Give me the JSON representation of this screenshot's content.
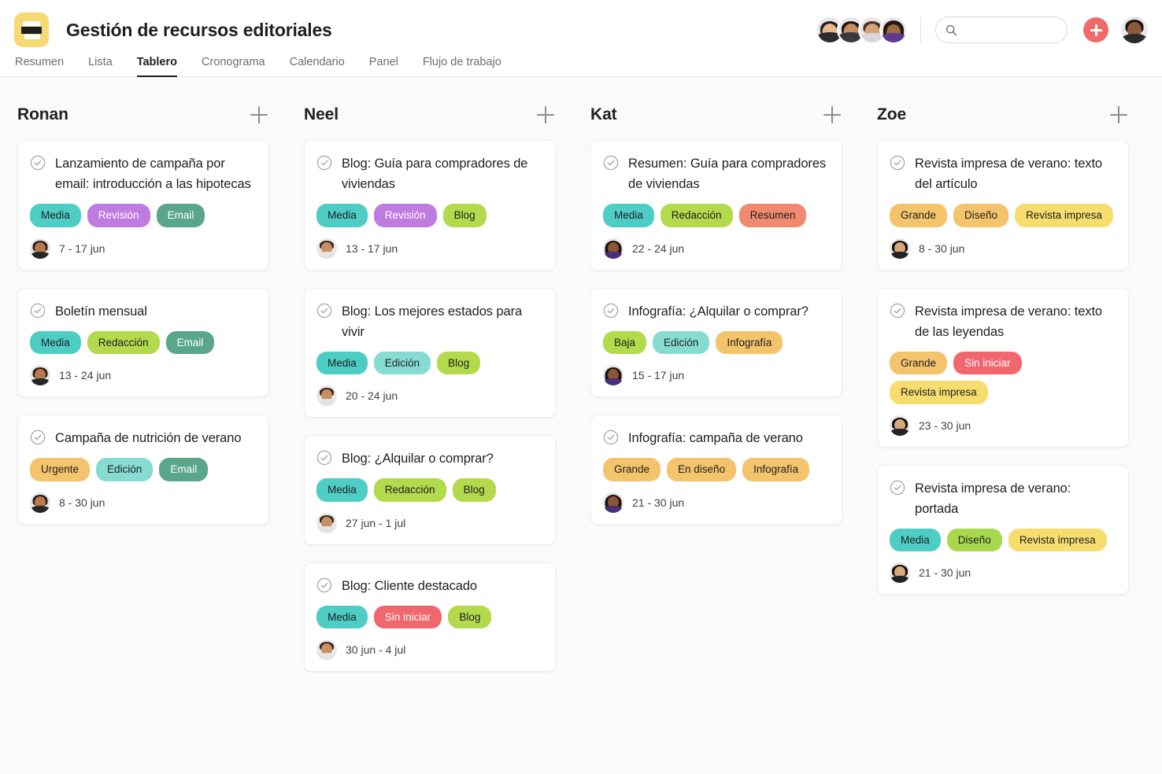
{
  "header": {
    "logo_icon": "project-logo-icon",
    "project_title": "Gestión de recursos editoriales",
    "search": {
      "placeholder": "",
      "value": "",
      "icon": "search-icon"
    },
    "add_button_label": "+",
    "member_avatars": [
      "member-1",
      "member-2",
      "member-3",
      "member-4"
    ],
    "current_user_avatar": "current-user"
  },
  "tabs": [
    {
      "label": "Resumen",
      "active": false
    },
    {
      "label": "Lista",
      "active": false
    },
    {
      "label": "Tablero",
      "active": true
    },
    {
      "label": "Cronograma",
      "active": false
    },
    {
      "label": "Calendario",
      "active": false
    },
    {
      "label": "Panel",
      "active": false
    },
    {
      "label": "Flujo de trabajo",
      "active": false
    }
  ],
  "tag_colors": {
    "Media": "#4ecdc4",
    "Revisión": "#c07be0",
    "Email": "#59a68a",
    "Redacción": "#b3d94c",
    "Urgente": "#f3c46b",
    "Edición": "#86dcd2",
    "Blog": "#b3d94c",
    "Sin iniciar": "#f2666e",
    "Resumen": "#ef8a6e",
    "Baja": "#b3d94c",
    "Infografía": "#f3c46b",
    "Grande": "#f3c46b",
    "En diseño": "#f3c46b",
    "Diseño-orange": "#f3c46b",
    "Diseño-green": "#a8d94c",
    "Revista impresa": "#f6dd6e"
  },
  "columns": [
    {
      "title": "Ronan",
      "add_label": "+",
      "avatar_kind": "ronan",
      "cards": [
        {
          "title": "Lanzamiento de campaña por email: introducción a las hipotecas",
          "tags": [
            {
              "label": "Media",
              "color": "#4ecdc4",
              "text_color": "#1e1f21"
            },
            {
              "label": "Revisión",
              "color": "#c07be0",
              "text_color": "#ffffff"
            },
            {
              "label": "Email",
              "color": "#59a68a",
              "text_color": "#ffffff"
            }
          ],
          "date": "7 - 17 jun"
        },
        {
          "title": "Boletín mensual",
          "tags": [
            {
              "label": "Media",
              "color": "#4ecdc4",
              "text_color": "#1e1f21"
            },
            {
              "label": "Redacción",
              "color": "#b3d94c",
              "text_color": "#1e1f21"
            },
            {
              "label": "Email",
              "color": "#59a68a",
              "text_color": "#ffffff"
            }
          ],
          "date": "13 - 24 jun"
        },
        {
          "title": "Campaña de nutrición de verano",
          "tags": [
            {
              "label": "Urgente",
              "color": "#f3c46b",
              "text_color": "#1e1f21"
            },
            {
              "label": "Edición",
              "color": "#86dcd2",
              "text_color": "#1e1f21"
            },
            {
              "label": "Email",
              "color": "#59a68a",
              "text_color": "#ffffff"
            }
          ],
          "date": "8 - 30 jun"
        }
      ]
    },
    {
      "title": "Neel",
      "add_label": "+",
      "avatar_kind": "neel",
      "cards": [
        {
          "title": "Blog: Guía para compradores de viviendas",
          "tags": [
            {
              "label": "Media",
              "color": "#4ecdc4",
              "text_color": "#1e1f21"
            },
            {
              "label": "Revisión",
              "color": "#c07be0",
              "text_color": "#ffffff"
            },
            {
              "label": "Blog",
              "color": "#b3d94c",
              "text_color": "#1e1f21"
            }
          ],
          "date": "13 - 17 jun"
        },
        {
          "title": "Blog: Los mejores estados para vivir",
          "tags": [
            {
              "label": "Media",
              "color": "#4ecdc4",
              "text_color": "#1e1f21"
            },
            {
              "label": "Edición",
              "color": "#86dcd2",
              "text_color": "#1e1f21"
            },
            {
              "label": "Blog",
              "color": "#b3d94c",
              "text_color": "#1e1f21"
            }
          ],
          "date": "20 - 24 jun"
        },
        {
          "title": "Blog: ¿Alquilar o comprar?",
          "tags": [
            {
              "label": "Media",
              "color": "#4ecdc4",
              "text_color": "#1e1f21"
            },
            {
              "label": "Redacción",
              "color": "#b3d94c",
              "text_color": "#1e1f21"
            },
            {
              "label": "Blog",
              "color": "#b3d94c",
              "text_color": "#1e1f21"
            }
          ],
          "date": "27 jun - 1 jul"
        },
        {
          "title": "Blog: Cliente destacado",
          "tags": [
            {
              "label": "Media",
              "color": "#4ecdc4",
              "text_color": "#1e1f21"
            },
            {
              "label": "Sin iniciar",
              "color": "#f2666e",
              "text_color": "#ffffff"
            },
            {
              "label": "Blog",
              "color": "#b3d94c",
              "text_color": "#1e1f21"
            }
          ],
          "date": "30 jun - 4 jul"
        }
      ]
    },
    {
      "title": "Kat",
      "add_label": "+",
      "avatar_kind": "kat",
      "cards": [
        {
          "title": "Resumen: Guía para compradores de viviendas",
          "tags": [
            {
              "label": "Media",
              "color": "#4ecdc4",
              "text_color": "#1e1f21"
            },
            {
              "label": "Redacción",
              "color": "#b3d94c",
              "text_color": "#1e1f21"
            },
            {
              "label": "Resumen",
              "color": "#ef8a6e",
              "text_color": "#1e1f21"
            }
          ],
          "date": "22 - 24 jun"
        },
        {
          "title": "Infografía: ¿Alquilar o comprar?",
          "tags": [
            {
              "label": "Baja",
              "color": "#b3d94c",
              "text_color": "#1e1f21"
            },
            {
              "label": "Edición",
              "color": "#86dcd2",
              "text_color": "#1e1f21"
            },
            {
              "label": "Infografía",
              "color": "#f3c46b",
              "text_color": "#1e1f21"
            }
          ],
          "date": "15 - 17 jun"
        },
        {
          "title": "Infografía: campaña de verano",
          "tags": [
            {
              "label": "Grande",
              "color": "#f3c46b",
              "text_color": "#1e1f21"
            },
            {
              "label": "En diseño",
              "color": "#f3c46b",
              "text_color": "#1e1f21"
            },
            {
              "label": "Infografía",
              "color": "#f3c46b",
              "text_color": "#1e1f21"
            }
          ],
          "date": "21 - 30 jun"
        }
      ]
    },
    {
      "title": "Zoe",
      "add_label": "+",
      "avatar_kind": "zoe",
      "cards": [
        {
          "title": "Revista impresa de verano: texto del artículo",
          "tags": [
            {
              "label": "Grande",
              "color": "#f3c46b",
              "text_color": "#1e1f21"
            },
            {
              "label": "Diseño",
              "color": "#f3c46b",
              "text_color": "#1e1f21"
            },
            {
              "label": "Revista impresa",
              "color": "#f6dd6e",
              "text_color": "#1e1f21"
            }
          ],
          "date": "8 - 30 jun"
        },
        {
          "title": "Revista impresa de verano: texto de las leyendas",
          "tags": [
            {
              "label": "Grande",
              "color": "#f3c46b",
              "text_color": "#1e1f21"
            },
            {
              "label": "Sin iniciar",
              "color": "#f2666e",
              "text_color": "#ffffff"
            },
            {
              "label": "Revista impresa",
              "color": "#f6dd6e",
              "text_color": "#1e1f21"
            }
          ],
          "date": "23 - 30 jun"
        },
        {
          "title": "Revista impresa de verano: portada",
          "tags": [
            {
              "label": "Media",
              "color": "#4ecdc4",
              "text_color": "#1e1f21"
            },
            {
              "label": "Diseño",
              "color": "#a8d94c",
              "text_color": "#1e1f21"
            },
            {
              "label": "Revista impresa",
              "color": "#f6dd6e",
              "text_color": "#1e1f21"
            }
          ],
          "date": "21 - 30 jun"
        }
      ]
    }
  ]
}
